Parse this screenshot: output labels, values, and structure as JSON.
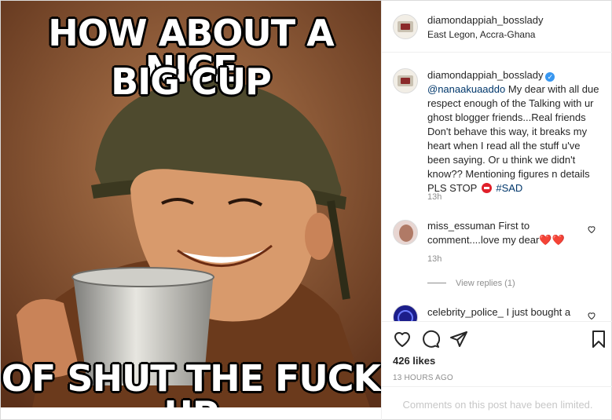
{
  "meme": {
    "top_line_1": "HOW ABOUT A NICE",
    "top_line_2": "BIG CUP",
    "bottom_line": "OF SHUT THE FUCK UP"
  },
  "header": {
    "username": "diamondappiah_bosslady",
    "location": "East Legon, Accra-Ghana"
  },
  "caption": {
    "username": "diamondappiah_bosslady",
    "verified_icon": "check",
    "mention": "@nanaakuaaddo",
    "text": "My dear with all due respect enough of the Talking with ur ghost blogger friends...Real friends Don't behave this way, it breaks my heart when I read all the stuff u've been saying. Or u think we didn't know?? Mentioning figures n details PLS STOP",
    "emoji": "no-entry",
    "hashtag": "#SAD",
    "time": "13h"
  },
  "comments": [
    {
      "username": "miss_essuman",
      "text": "First to comment....love my dear",
      "emoji": "❤️❤️",
      "time": "13h",
      "view_replies": "View replies (1)"
    },
    {
      "username": "celebrity_police_",
      "text": "I just bought a"
    }
  ],
  "actions": {
    "likes": "426 likes",
    "time_ago": "13 HOURS AGO",
    "comments_limited": "Comments on this post have been limited."
  },
  "icons": {
    "like": "heart-outline-icon",
    "comment": "speech-bubble-icon",
    "share": "paper-plane-icon",
    "save": "bookmark-icon"
  },
  "colors": {
    "link": "#00376b",
    "verified": "#3897f0",
    "muted": "#8e8e8e",
    "border": "#dbdbdb"
  }
}
